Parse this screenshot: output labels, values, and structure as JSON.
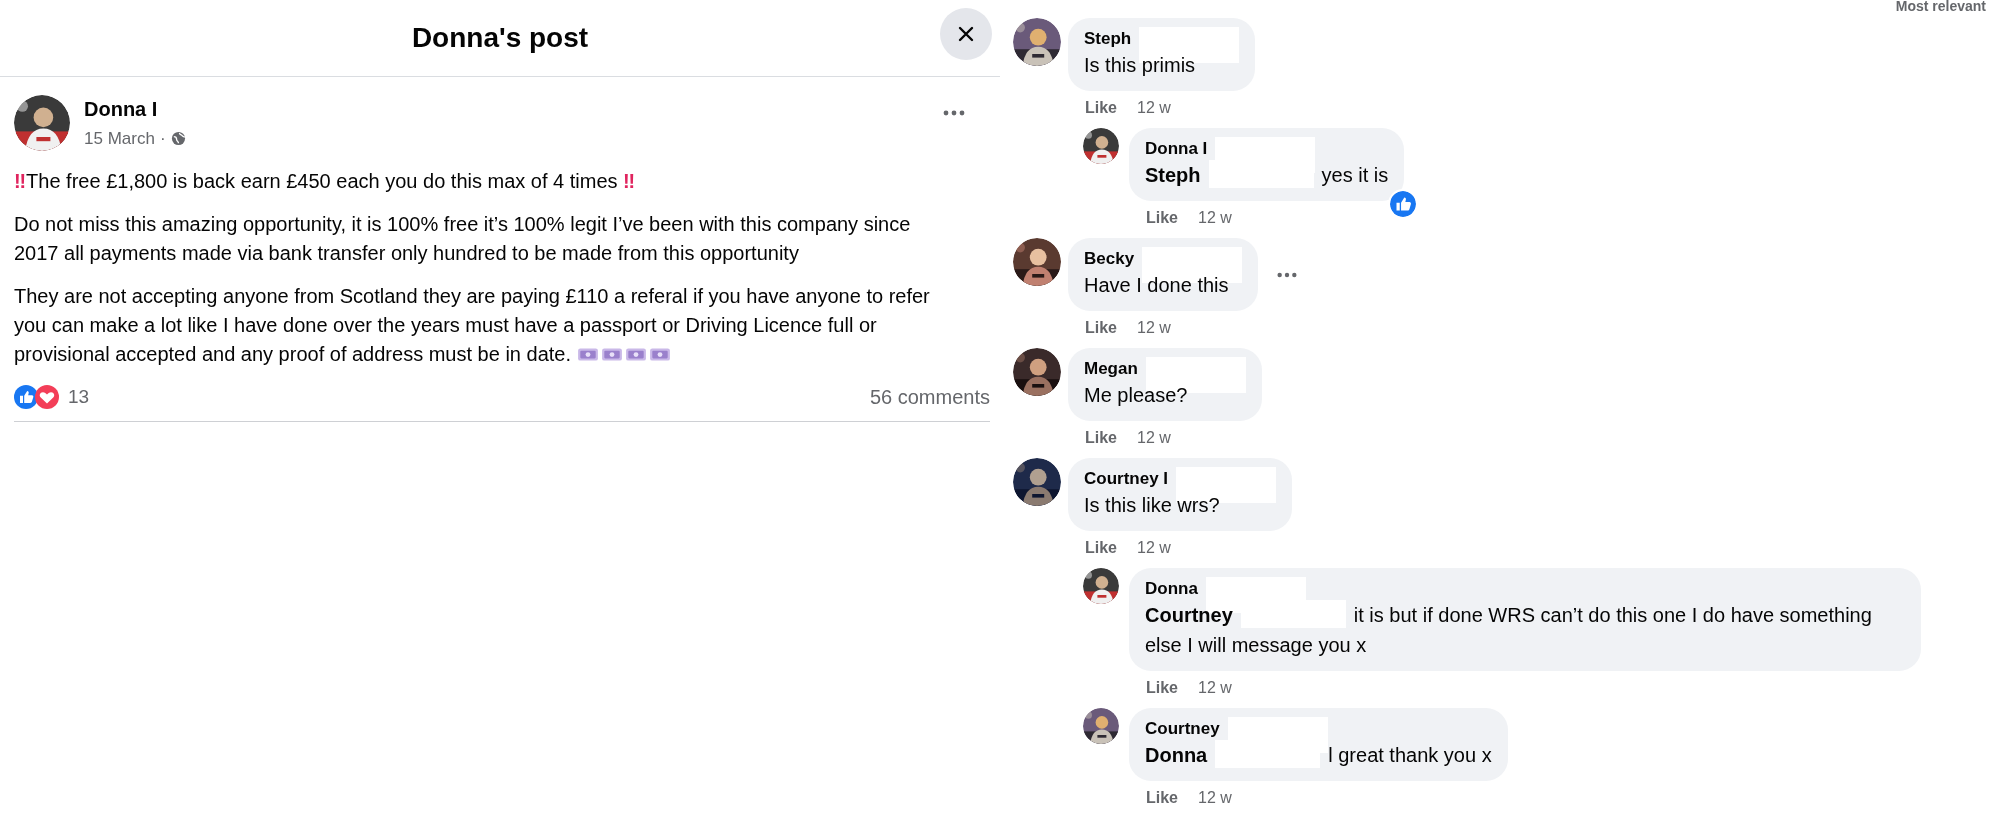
{
  "dialog": {
    "title": "Donna's post"
  },
  "post": {
    "author": "Donna I",
    "date": "15 March",
    "separator": "·",
    "headline": {
      "lead": "‼",
      "text": "The free £1,800 is back earn £450 each you do this max of 4 times",
      "trail": "‼"
    },
    "paragraphs": [
      "Do not miss this amazing opportunity, it is 100% free it’s 100% legit I’ve been with this company since 2017 all payments made via bank transfer only hundred to be made from this opportunity",
      "They are not accepting anyone from Scotland they are paying £110 a referal if you have anyone to refer you can make a lot like I have done over the years must have a passport or Driving Licence full or provisional accepted and any proof of address must be in date."
    ],
    "emoji": [
      {
        "kind": "money"
      },
      {
        "kind": "money"
      },
      {
        "kind": "money"
      },
      {
        "kind": "money"
      }
    ],
    "reactions": [
      {
        "kind": "like"
      },
      {
        "kind": "love"
      }
    ],
    "reaction_count": "13",
    "comment_count": "56 comments"
  },
  "sort_label": "Most relevant",
  "comments": [
    {
      "author": "Steph",
      "redacted": true,
      "text": "Is this primis",
      "like": "Like",
      "time": "12 w",
      "more": false,
      "liked": false,
      "children": [
        {
          "author": "Donna I",
          "redacted": true,
          "mention": "Steph",
          "text": "yes it is",
          "like": "Like",
          "time": "12 w",
          "more": false,
          "liked": true
        }
      ]
    },
    {
      "author": "Becky",
      "redacted": true,
      "text": "Have I done this",
      "like": "Like",
      "time": "12 w",
      "more": true,
      "liked": false
    },
    {
      "author": "Megan",
      "redacted": true,
      "text": "Me please?",
      "like": "Like",
      "time": "12 w",
      "more": false,
      "liked": false
    },
    {
      "author": "Courtney I",
      "redacted": true,
      "text": "Is this like wrs?",
      "like": "Like",
      "time": "12 w",
      "more": false,
      "liked": false,
      "children": [
        {
          "author": "Donna",
          "redacted": true,
          "mention": "Courtney",
          "text": "it is but if done WRS can’t do this one I do have something else I will message you x",
          "like": "Like",
          "time": "12 w",
          "more": false,
          "liked": false
        },
        {
          "author": "Courtney",
          "redacted": true,
          "mention": "Donna",
          "text": "l great thank you x",
          "like": "Like",
          "time": "12 w",
          "more": false,
          "liked": false
        }
      ]
    }
  ]
}
